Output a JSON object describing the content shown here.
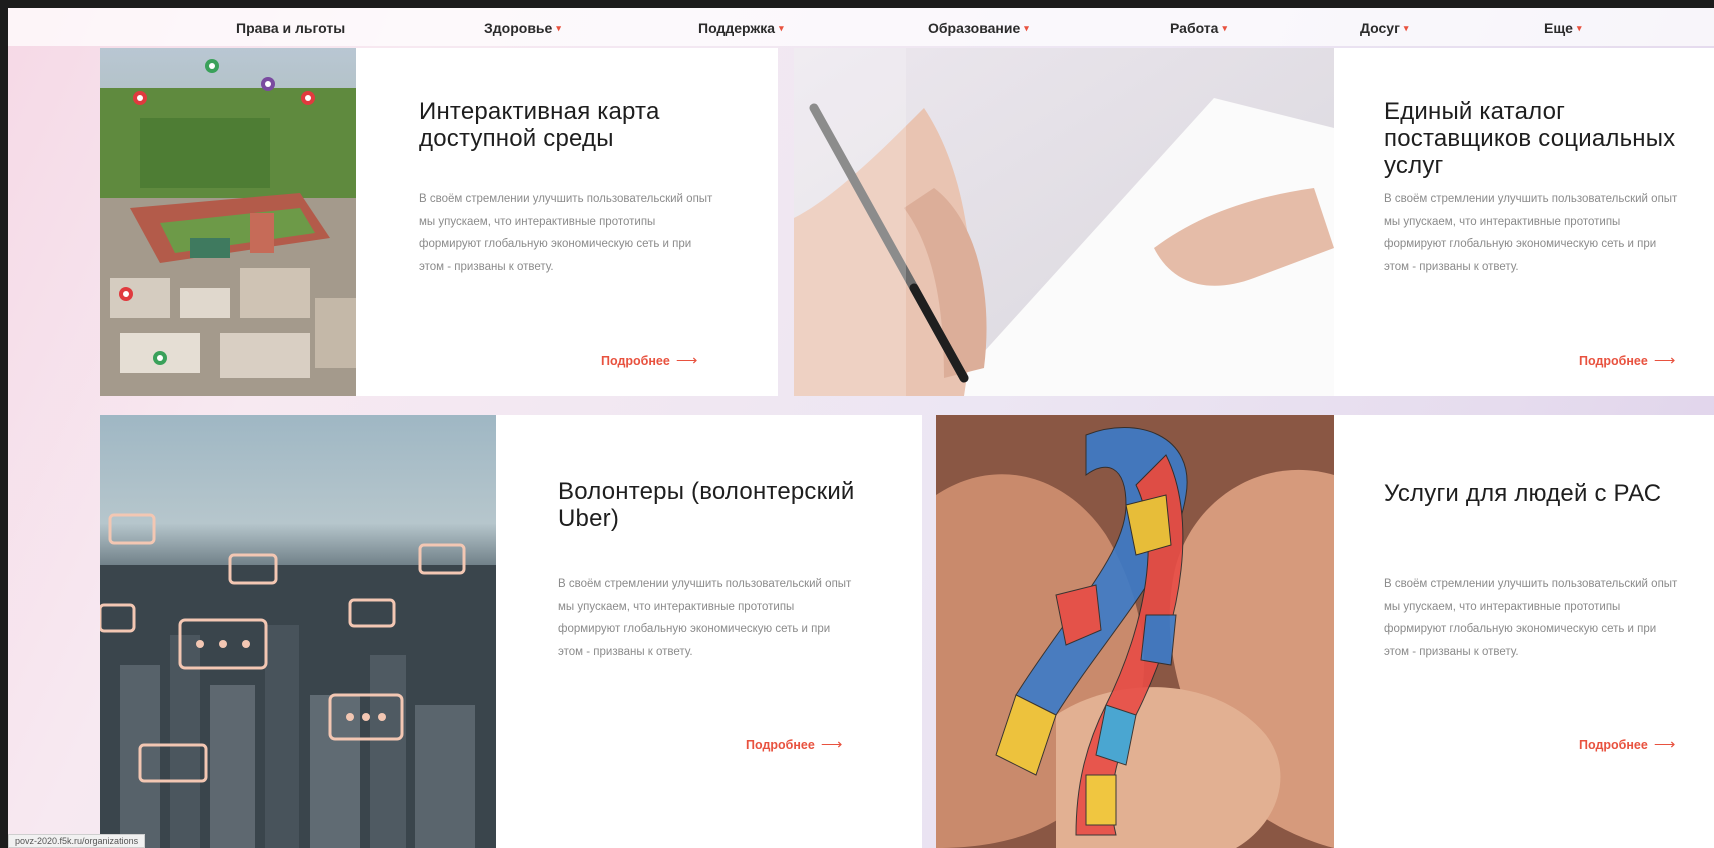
{
  "nav": {
    "items": [
      {
        "label": "Права и льготы",
        "dropdown": false
      },
      {
        "label": "Здоровье",
        "dropdown": true
      },
      {
        "label": "Поддержка",
        "dropdown": true
      },
      {
        "label": "Образование",
        "dropdown": true
      },
      {
        "label": "Работа",
        "dropdown": true
      },
      {
        "label": "Досуг",
        "dropdown": true
      },
      {
        "label": "Еще",
        "dropdown": true
      }
    ],
    "chevron": "▾"
  },
  "cards": [
    {
      "title": "Интерактивная карта доступной среды",
      "description": "В своём стремлении улучшить пользовательский опыт мы упускаем, что интерактивные прототипы формируют глобальную экономическую сеть и при этом - призваны к ответу.",
      "more": "Подробнее",
      "image": "city-map-with-pins"
    },
    {
      "title": "Единый каталог поставщиков социальных услуг",
      "description": "В своём стремлении улучшить пользовательский опыт мы упускаем, что интерактивные прототипы формируют глобальную экономическую сеть и при этом - призваны к ответу.",
      "more": "Подробнее",
      "image": "hand-writing-with-pen"
    },
    {
      "title": "Волонтеры (волонтерский Uber)",
      "description": "В своём стремлении улучшить пользовательский опыт мы упускаем, что интерактивные прототипы формируют глобальную экономическую сеть и при этом - призваны к ответу.",
      "more": "Подробнее",
      "image": "city-night-chat-bubbles"
    },
    {
      "title": "Услуги для людей с РАС",
      "description": "В своём стремлении улучшить пользовательский опыт мы упускаем, что интерактивные прототипы формируют глобальную экономическую сеть и при этом - призваны к ответу.",
      "more": "Подробнее",
      "image": "puzzle-ribbon-in-hands"
    }
  ],
  "arrow": "⟶",
  "status_url": "povz-2020.f5k.ru/organizations",
  "colors": {
    "accent": "#e8523f",
    "text": "#1e1e1e",
    "muted": "#8b8b8b"
  }
}
